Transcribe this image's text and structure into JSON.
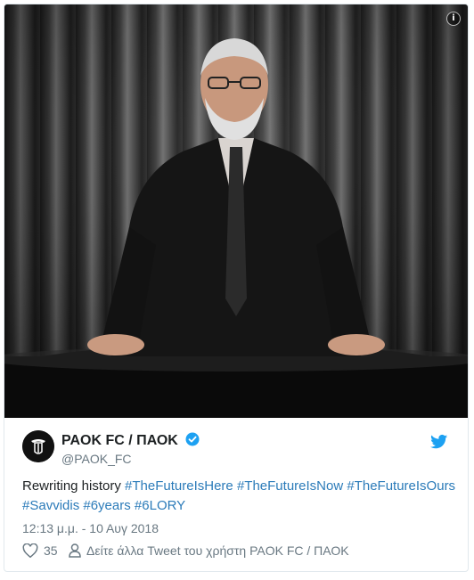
{
  "tweet": {
    "display_name": "PAOK FC / ΠΑΟΚ",
    "handle": "@PAOK_FC",
    "text_plain": "Rewriting history ",
    "hashtags": [
      "#TheFutureIsHere",
      "#TheFutureIsNow",
      "#TheFutureIsOurs",
      "#Savvidis",
      "#6years",
      "#6LORY"
    ],
    "timestamp": "12:13 μ.μ. - 10 Αυγ 2018",
    "like_count": "35",
    "more_tweets_label": "Δείτε άλλα Tweet του χρήστη PAOK FC / ΠΑΟΚ"
  },
  "icons": {
    "info": "info-icon",
    "verified": "verified-badge-icon",
    "bird": "twitter-bird-icon",
    "heart": "heart-icon",
    "person": "person-icon"
  },
  "colors": {
    "link": "#2b7bb9",
    "verified": "#1da1f2",
    "bird": "#1da1f2",
    "muted": "#697882",
    "text": "#1c2022"
  }
}
